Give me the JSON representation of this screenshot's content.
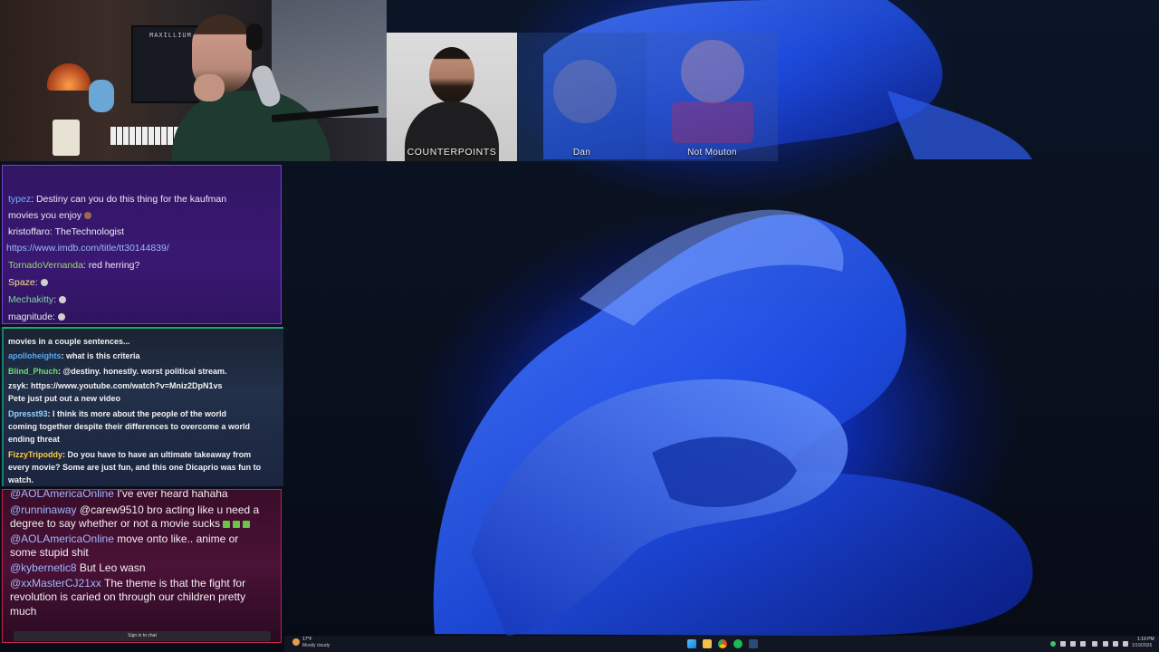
{
  "webcam": {
    "monitor_label": "MAXILLIUM"
  },
  "call_tiles": [
    {
      "name": "COUNTERPOINTS"
    },
    {
      "name": "Dan"
    },
    {
      "name": "Not Mouton"
    }
  ],
  "chat1": {
    "messages": [
      {
        "user": "typez",
        "text": ": Destiny can you do this thing for the kaufman",
        "color": "#6fb3ff"
      },
      {
        "user": "",
        "text": "movies you enjoy"
      },
      {
        "user": "kristoffaro",
        "text": ": TheTechnologist",
        "color": "#eeeaf6"
      },
      {
        "user": "",
        "text": "https://www.imdb.com/title/tt30144839/",
        "link": true
      },
      {
        "user": "TornadoVernanda",
        "text": ": red herring?",
        "color": "#9cd86a"
      },
      {
        "user": "Spaze",
        "text": ":",
        "color": "#ffe28a"
      },
      {
        "user": "Mechakitty",
        "text": ":",
        "color": "#7fd6a8"
      },
      {
        "user": "magnitude",
        "text": ":",
        "color": "#eeeaf6"
      }
    ]
  },
  "chat2": {
    "lines": [
      {
        "user": "",
        "text": "movies in a couple sentences..."
      },
      {
        "user": "apolloheights",
        "text": ": what is this criteria",
        "color": "#59a8f5"
      },
      {
        "user": "Blind_Phuch",
        "text": ": @destiny. honestly. worst political stream.",
        "color": "#6fdc6f"
      },
      {
        "user": "zsyk",
        "text": ": https://www.youtube.com/watch?v=Mniz2DpN1vs",
        "color": "#f1f1f1"
      },
      {
        "user": "",
        "text": "Pete just put out a new video"
      },
      {
        "user": "Dpresst93",
        "text": ": I think its more about the people of the world",
        "color": "#9ad0ff"
      },
      {
        "user": "",
        "text": "coming together despite their differences to overcome a world"
      },
      {
        "user": "",
        "text": "ending threat"
      },
      {
        "user": "FizzyTripoddy",
        "text": ": Do you have to have an ultimate takeaway from",
        "color": "#ffcf40"
      },
      {
        "user": "",
        "text": "every movie? Some are just fun, and this one Dicaprio was fun to"
      },
      {
        "user": "",
        "text": "watch."
      }
    ]
  },
  "chat3": {
    "lines": [
      {
        "user": "@AOLAmericaOnline",
        "text": " I've ever heard hahaha"
      },
      {
        "user": "@runninaway",
        "text": " @carew9510 bro acting like u need a"
      },
      {
        "user": "",
        "text": "degree to say whether or not a movie sucks"
      },
      {
        "user": "@AOLAmericaOnline",
        "text": " move onto like.. anime or"
      },
      {
        "user": "",
        "text": "some stupid shit"
      },
      {
        "user": "@kybernetic8",
        "text": " But Leo wasn"
      },
      {
        "user": "@xxMasterCJ21xx",
        "text": " The theme is that the fight for"
      },
      {
        "user": "",
        "text": "revolution is caried on through our children pretty"
      },
      {
        "user": "",
        "text": "much"
      }
    ],
    "signin_label": "Sign in to chat"
  },
  "taskbar": {
    "weather_temp": "17°F",
    "weather_condition": "Mostly cloudy",
    "clock_time": "1:19 PM",
    "clock_date": "1/19/2026",
    "pinned_apps": [
      "start-icon",
      "file-explorer-icon",
      "chrome-icon",
      "spotify-icon",
      "steam-icon"
    ]
  },
  "colors": {
    "accent_purple": "#7c3fd1",
    "accent_green": "#1ea57a",
    "accent_red": "#c02546",
    "wallpaper_blue": "#1a3fd8"
  }
}
